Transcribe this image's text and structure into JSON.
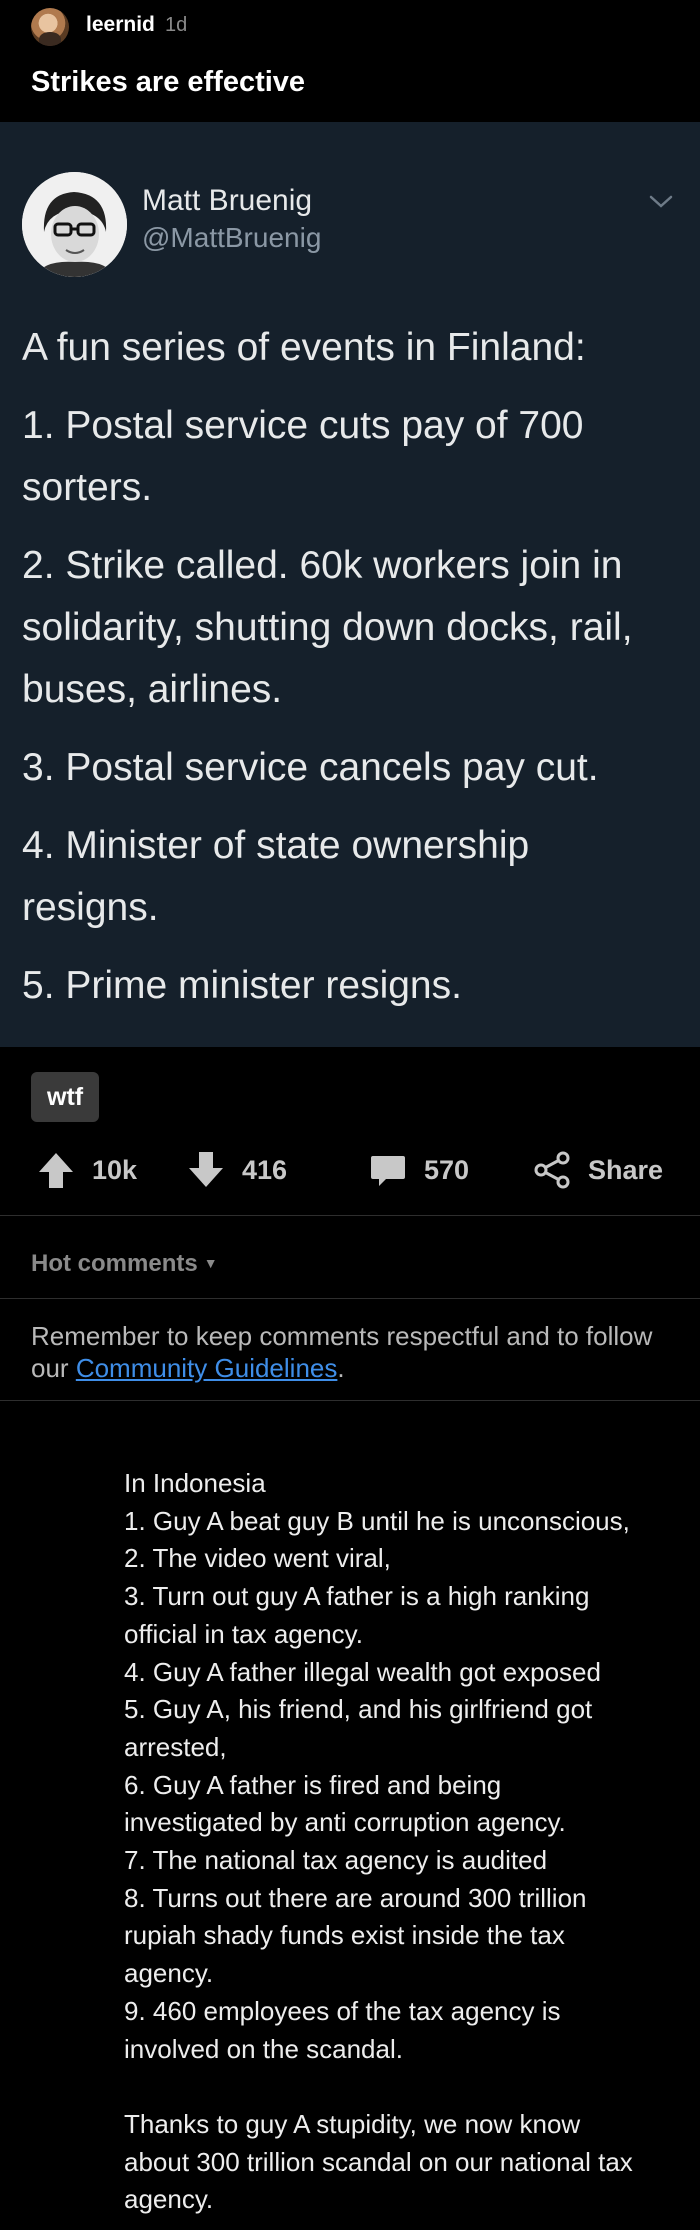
{
  "post": {
    "username": "leernid",
    "age": "1d",
    "title": "Strikes are effective",
    "flair": "wtf"
  },
  "tweet": {
    "name": "Matt Bruenig",
    "handle": "@MattBruenig",
    "lines": [
      "A fun series of events in Finland:",
      "1. Postal service cuts pay of 700",
      "sorters.",
      "2. Strike called. 60k workers join in",
      "solidarity, shutting down docks, rail,",
      "buses, airlines.",
      "3. Postal service cancels pay cut.",
      "4. Minister of state ownership",
      "resigns.",
      "5. Prime minister resigns."
    ]
  },
  "actions": {
    "upvotes": "10k",
    "downvotes": "416",
    "comments": "570",
    "share": "Share"
  },
  "comments_section": {
    "sort_label": "Hot comments",
    "guidelines_text": "Remember to keep comments respectful and to follow our ",
    "guidelines_link": "Community Guidelines",
    "guidelines_end": "."
  },
  "comment": {
    "lines": [
      "In Indonesia",
      "1. Guy A beat guy B until he is unconscious,",
      "2. The video went viral,",
      "3. Turn out guy A father is a high ranking",
      "official in tax agency.",
      "4. Guy A father illegal wealth got exposed",
      "5. Guy A, his friend, and his girlfriend got",
      "arrested,",
      "6. Guy A father is fired and being",
      "investigated by anti corruption agency.",
      "7. The national tax agency is audited",
      "8. Turns out there are around 300 trillion",
      "rupiah shady funds exist inside the tax",
      "agency.",
      "9. 460 employees of the tax agency is",
      "involved on the scandal.",
      "",
      "Thanks to guy A stupidity, we now know",
      "about 300 trillion scandal on our national tax",
      "agency."
    ]
  },
  "colors": {
    "background": "#000000",
    "tweet_background": "#15202b",
    "link": "#3f8ee8"
  }
}
